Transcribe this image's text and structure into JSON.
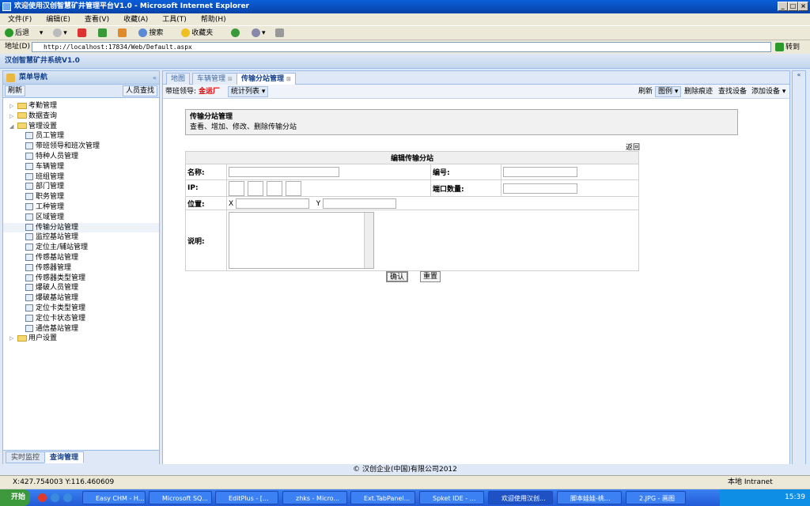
{
  "window": {
    "title": "欢迎使用汉创智慧矿井管理平台V1.0 - Microsoft Internet Explorer"
  },
  "menu": [
    "文件(F)",
    "编辑(E)",
    "查看(V)",
    "收藏(A)",
    "工具(T)",
    "帮助(H)"
  ],
  "toolbar": {
    "back": "后退",
    "search": "搜索",
    "favorites": "收藏夹"
  },
  "address": {
    "label": "地址(D)",
    "url": "http://localhost:17834/Web/Default.aspx",
    "go": "转到"
  },
  "app": {
    "title": "汉创智慧矿井系统V1.0"
  },
  "left": {
    "title": "菜单导航",
    "refresh": "刷新",
    "find_person": "人员查找",
    "tree": [
      {
        "label": "考勤管理",
        "type": "folder"
      },
      {
        "label": "数据查询",
        "type": "folder"
      },
      {
        "label": "管理设置",
        "type": "folder-open"
      },
      {
        "label": "员工管理",
        "type": "leaf"
      },
      {
        "label": "带班领导和班次管理",
        "type": "leaf"
      },
      {
        "label": "特种人员管理",
        "type": "leaf"
      },
      {
        "label": "车辆管理",
        "type": "leaf"
      },
      {
        "label": "班组管理",
        "type": "leaf"
      },
      {
        "label": "部门管理",
        "type": "leaf"
      },
      {
        "label": "职务管理",
        "type": "leaf"
      },
      {
        "label": "工种管理",
        "type": "leaf"
      },
      {
        "label": "区域管理",
        "type": "leaf"
      },
      {
        "label": "传输分站管理",
        "type": "leaf"
      },
      {
        "label": "监控基站管理",
        "type": "leaf"
      },
      {
        "label": "定位主/辅站管理",
        "type": "leaf"
      },
      {
        "label": "传感基站管理",
        "type": "leaf"
      },
      {
        "label": "传感器管理",
        "type": "leaf"
      },
      {
        "label": "传感器类型管理",
        "type": "leaf"
      },
      {
        "label": "爆破人员管理",
        "type": "leaf"
      },
      {
        "label": "爆破基站管理",
        "type": "leaf"
      },
      {
        "label": "定位卡类型管理",
        "type": "leaf"
      },
      {
        "label": "定位卡状态管理",
        "type": "leaf"
      },
      {
        "label": "通信基站管理",
        "type": "leaf"
      },
      {
        "label": "用户设置",
        "type": "folder"
      }
    ],
    "bottom_tabs": [
      "实时监控",
      "查询管理"
    ]
  },
  "tabs": [
    {
      "label": "地图"
    },
    {
      "label": "车辆管理"
    },
    {
      "label": "传输分站管理"
    }
  ],
  "main_toolbar": {
    "leader_label": "带班领导:",
    "leader_name": "金运厂",
    "stats": "统计列表",
    "refresh": "刷新",
    "legend": "图例",
    "clear_trace": "删除痕迹",
    "find_device": "查找设备",
    "add_device": "添加设备"
  },
  "info": {
    "title": "传输分站管理",
    "desc": "查看、增加、修改、删除传输分站"
  },
  "form": {
    "back": "返回",
    "heading": "编辑传输分站",
    "name": "名称:",
    "code": "编号:",
    "ip": "IP:",
    "ports": "端口数量:",
    "position": "位置:",
    "x": "X",
    "y": "Y",
    "desc": "说明:",
    "confirm": "确认",
    "reset": "重置"
  },
  "footer": "© 汉创企业(中国)有限公司2012",
  "status": {
    "coords": "X:427.754003 Y:116.460609",
    "zone": "本地 Intranet"
  },
  "taskbar": {
    "start": "开始",
    "items": [
      "Easy CHM - H...",
      "Microsoft SQ...",
      "EditPlus - [...",
      "zhks - Micro...",
      "Ext.TabPanel...",
      "Spket IDE - ...",
      "欢迎使用汉创...",
      "脚本娃娃-桃...",
      "2.JPG - 画图"
    ],
    "time": "15:39"
  }
}
